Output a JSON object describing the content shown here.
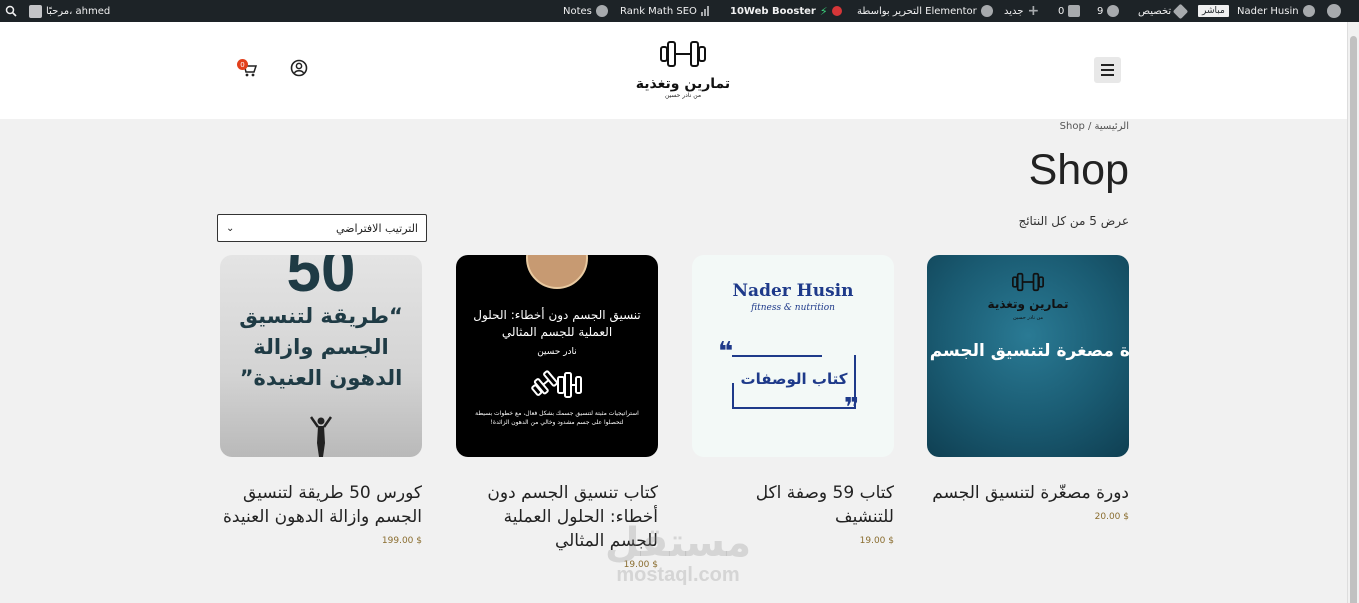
{
  "admin_bar": {
    "wp_logo": "wordpress-icon",
    "site_name": "Nader Husin",
    "live_badge": "مباشر",
    "customize": "تخصيص",
    "updates_count": "9",
    "comments_count": "0",
    "new": "جديد",
    "edit_with": "التحرير بواسطة Elementor",
    "booster": "10Web Booster",
    "rank_math": "Rank Math SEO",
    "notes": "Notes",
    "greeting": "مرحبًا، ahmed"
  },
  "header": {
    "logo_title": "تمارين وتغذية",
    "logo_subtitle": "من نادر حسين",
    "cart_count": "0"
  },
  "breadcrumb": "الرئيسية / Shop",
  "page_title": "Shop",
  "result_count": "عرض 5 من كل النتائج",
  "ordering": {
    "selected": "الترتيب الافتراضي"
  },
  "products": [
    {
      "title": "دورة مصغّرة لتنسيق الجسم",
      "price": "20.00 $",
      "image_logo_title": "تمارين وتغذية",
      "image_logo_subtitle": "من نادر حسين",
      "image_text": "دورة مصغرة لتنسيق الجسم"
    },
    {
      "title": "كتاب 59 وصفة اكل للتنشيف",
      "price": "19.00 $",
      "image_brand": "Nader Husin",
      "image_tagline": "fitness & nutrition",
      "image_text": "كتاب الوصفات"
    },
    {
      "title": "كتاب تنسيق الجسم دون أخطاء: الحلول العملية للجسم المثالي",
      "price": "19.00 $",
      "image_title": "تنسيق الجسم دون أخطاء: الحلول العملية للجسم المثالي",
      "image_author": "نادر حسين",
      "image_desc": "استراتيجيات مثبتة لتنسيق جسمك بشكل فعال، مع خطوات بسيطة لتحصلوا على جسم مشدود وخالي من الدهون الزائدة!"
    },
    {
      "title": "كورس 50 طريقة لتنسيق الجسم وازالة الدهون العنيدة",
      "price": "199.00 $",
      "image_number": "50",
      "image_text": "“طريقة لتنسيق الجسم وازالة الدهون العنيدة”"
    }
  ],
  "watermark": {
    "arabic": "مستقل",
    "latin": "mostaql.com"
  },
  "colors": {
    "admin_bar_bg": "#1d2327",
    "price": "#8a6d2f",
    "cart_badge": "#e2401c",
    "brand_blue": "#1e3a8a"
  }
}
